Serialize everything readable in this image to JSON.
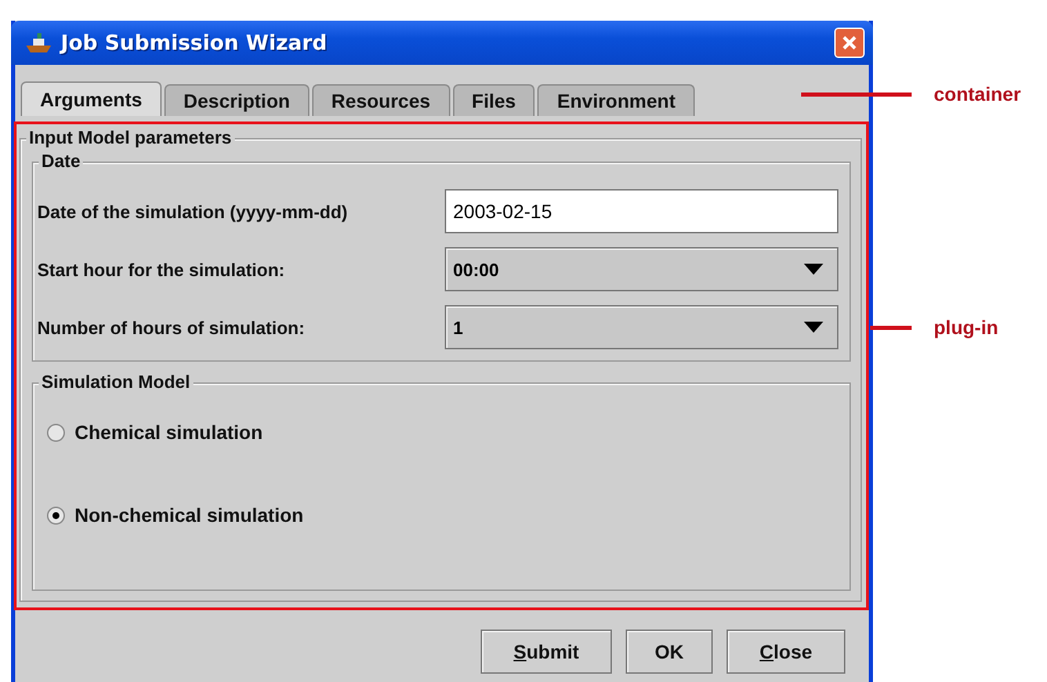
{
  "window": {
    "title": "Job Submission Wizard"
  },
  "tabs": [
    {
      "label": "Arguments",
      "selected": true
    },
    {
      "label": "Description",
      "selected": false
    },
    {
      "label": "Resources",
      "selected": false
    },
    {
      "label": "Files",
      "selected": false
    },
    {
      "label": "Environment",
      "selected": false
    }
  ],
  "panel": {
    "title": "Input Model parameters",
    "date_group": {
      "title": "Date",
      "fields": [
        {
          "kind": "text",
          "label": "Date of the simulation (yyyy-mm-dd)",
          "value": "2003-02-15"
        },
        {
          "kind": "combo",
          "label": "Start hour for the simulation:",
          "value": "00:00"
        },
        {
          "kind": "combo",
          "label": "Number of hours of simulation:",
          "value": "1"
        }
      ]
    },
    "model_group": {
      "title": "Simulation Model",
      "options": [
        {
          "label": "Chemical simulation",
          "selected": false
        },
        {
          "label": "Non-chemical simulation",
          "selected": true
        }
      ]
    }
  },
  "buttons": [
    {
      "label": "Submit",
      "mnemonic": true
    },
    {
      "label": "OK",
      "mnemonic": false
    },
    {
      "label": "Close",
      "mnemonic": true
    }
  ],
  "annotations": [
    {
      "kind": "container",
      "text": "container"
    },
    {
      "kind": "plugin",
      "text": "plug-in"
    }
  ]
}
